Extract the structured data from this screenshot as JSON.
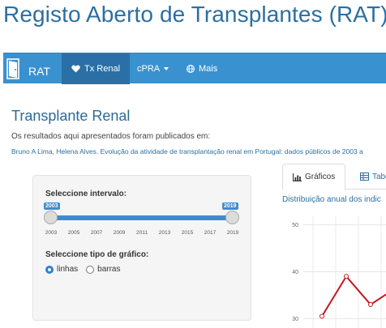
{
  "page_title": "Registo Aberto de Transplantes (RAT)",
  "navbar": {
    "brand": "RAT",
    "items": [
      {
        "label": "Tx Renal",
        "icon": "heart-icon",
        "active": true
      },
      {
        "label": "cPRA",
        "icon": null,
        "dropdown": true
      },
      {
        "label": "Mais",
        "icon": "globe-icon"
      }
    ]
  },
  "main": {
    "title": "Transplante Renal",
    "intro": "Os resultados aqui apresentados foram publicados em:",
    "citation": "Bruno A Lima, Helena Alves. Evolução da atividade de transplantação renal em Portugal: dados públicos de 2003 a"
  },
  "sidebar": {
    "interval_label": "Seleccione intervalo:",
    "range_from": "2003",
    "range_to": "2019",
    "ticks": [
      "2003",
      "2005",
      "2007",
      "2009",
      "2011",
      "2013",
      "2015",
      "2017",
      "2019"
    ],
    "chart_type_label": "Seleccione tipo de gráfico:",
    "options": [
      {
        "label": "linhas",
        "checked": true
      },
      {
        "label": "barras",
        "checked": false
      }
    ]
  },
  "tabs": [
    {
      "label": "Gráficos",
      "icon": "bar-chart-icon",
      "active": true
    },
    {
      "label": "Tabe",
      "icon": "table-icon",
      "active": false
    }
  ],
  "chart_title": "Distribuição anual dos indic",
  "chart_data": {
    "type": "line",
    "title": "Distribuição anual dos indic",
    "xlabel": "",
    "ylabel": "",
    "y_ticks": [
      30,
      40,
      50
    ],
    "ylim": [
      28,
      52
    ],
    "grid": true,
    "series": [
      {
        "color": "#c0181e",
        "values": [
          30.5,
          39,
          33,
          35.5
        ]
      }
    ]
  }
}
